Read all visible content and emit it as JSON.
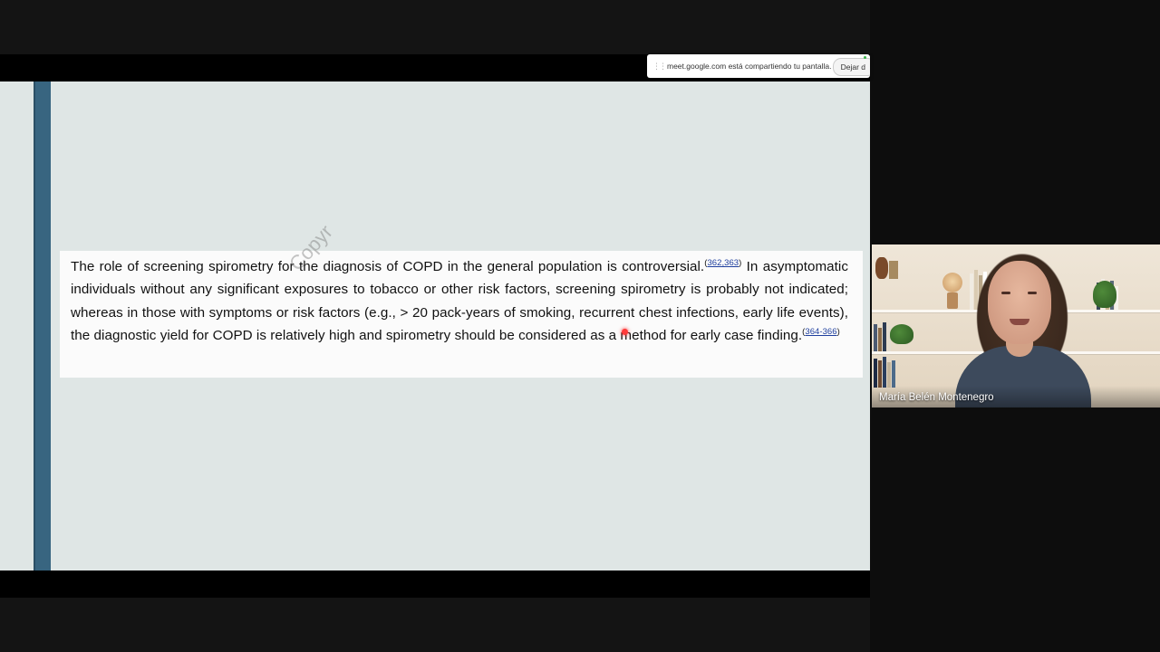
{
  "share_banner": {
    "message": "meet.google.com está compartiendo tu pantalla.",
    "stop_label": "Dejar d"
  },
  "slide": {
    "watermark": "Copyr",
    "paragraph": {
      "part1": "The role of screening spirometry for the diagnosis of COPD in the general population is controversial.",
      "ref1_open": "(",
      "ref1": "362,363",
      "ref1_close": ")",
      "part2": " In asymptomatic individuals without any significant exposures to tobacco or other risk factors, screening spirometry is probably not indicated; whereas in those with symptoms or risk factors (e.g., > 20 pack-years of smoking, recurrent chest infections, early life events), the diagnostic yield for COPD is relatively high and spirometry should be considered as a method for early case finding.",
      "ref2_open": "(",
      "ref2": "364-366",
      "ref2_close": ")"
    }
  },
  "video": {
    "participant_name": "María Belén Montenegro"
  },
  "colors": {
    "slide_background": "#dfe6e5",
    "slide_accent": "#386580",
    "reference_link": "#1f3f9e",
    "laser_pointer": "#ff3b3b"
  }
}
